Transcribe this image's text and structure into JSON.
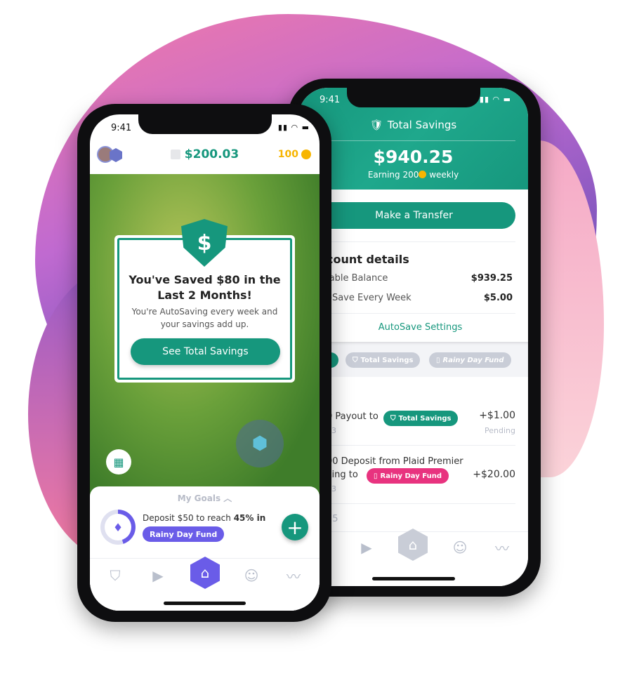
{
  "back_phone": {
    "status_time": "9:41",
    "header_title": "Total Savings",
    "balance": "$940.25",
    "earning_prefix": "Earning 200",
    "earning_suffix": "weekly",
    "transfer_button": "Make a Transfer",
    "account_details_title": "count details",
    "details": [
      {
        "label": "lable Balance",
        "value": "$939.25"
      },
      {
        "label": "oSave Every Week",
        "value": "$5.00"
      }
    ],
    "autosave_settings_link": "AutoSave Settings",
    "filter_chips": [
      "Total Savings",
      "Rainy Day Fund"
    ],
    "activity_heading": "y",
    "transactions": [
      {
        "line1": "0 Payout to",
        "chip": "Total Savings",
        "date": "03",
        "amount": "+$1.00",
        "status": "Pending"
      },
      {
        "line1": "00 Deposit from Plaid Premier",
        "line2": "king to",
        "chip": "Rainy Day Fund",
        "date": "03",
        "amount": "+$20.00"
      }
    ],
    "next_date": "15"
  },
  "front_phone": {
    "status_time": "9:41",
    "balance": "$200.03",
    "coins": "100",
    "card": {
      "title": "You've Saved $80 in the Last 2 Months!",
      "body": "You're AutoSaving every week and your savings add up.",
      "button": "See Total Savings"
    },
    "goals": {
      "heading": "My Goals",
      "text_prefix": "Deposit $50 to reach ",
      "text_bold": "45% in",
      "fund_chip": "Rainy Day Fund",
      "progress_percent": 45
    }
  },
  "colors": {
    "teal": "#16977d",
    "purple": "#6a5ce8",
    "pink": "#e8337f",
    "coin": "#f7b500"
  }
}
